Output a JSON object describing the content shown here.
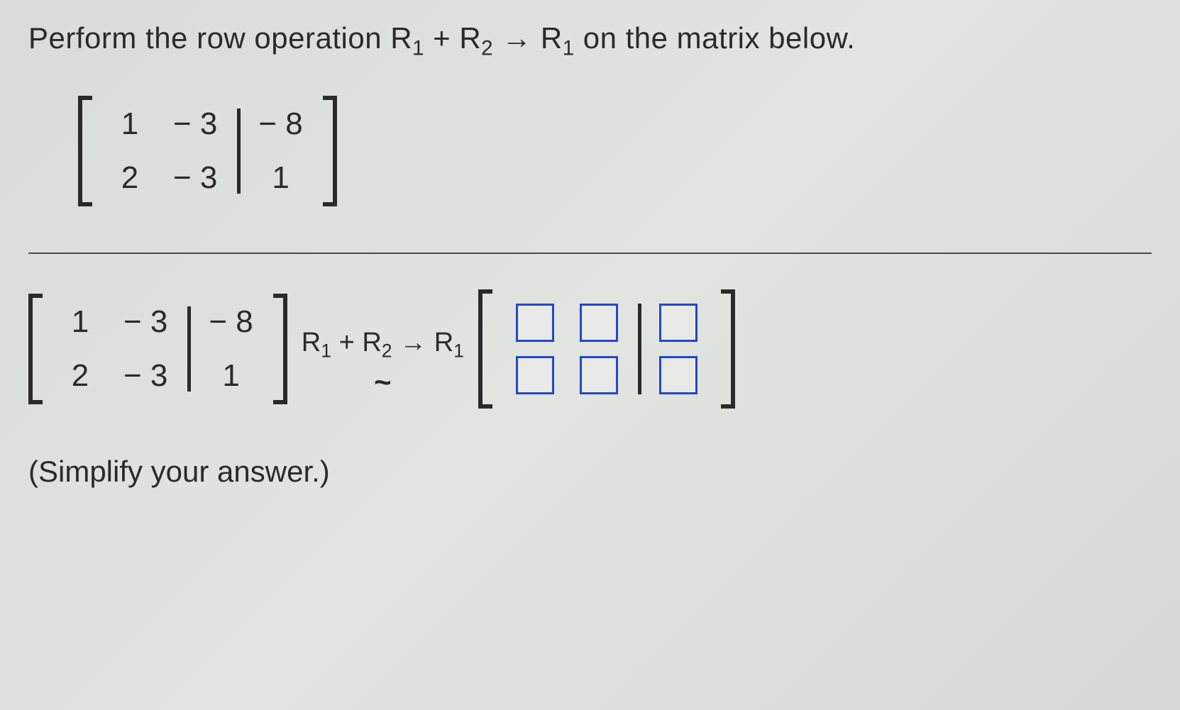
{
  "question": {
    "prefix": "Perform the row operation ",
    "op_r1": "R",
    "op_sub1": "1",
    "op_plus": " + ",
    "op_r2": "R",
    "op_sub2": "2",
    "op_arrow": "→",
    "op_r3": "R",
    "op_sub3": "1",
    "suffix": " on the matrix below."
  },
  "matrix": {
    "r1c1": "1",
    "r1c2": "− 3",
    "r1c3": "− 8",
    "r2c1": "2",
    "r2c2": "− 3",
    "r2c3": "1"
  },
  "answer_op": {
    "r1": "R",
    "s1": "1",
    "plus": " + ",
    "r2": "R",
    "s2": "2",
    "arrow": "→",
    "r3": "R",
    "s3": "1"
  },
  "simplify": "(Simplify your answer.)",
  "chart_data": {
    "type": "table",
    "title": "Augmented matrix row operation",
    "operation": "R1 + R2 -> R1",
    "input_matrix": [
      [
        1,
        -3,
        -8
      ],
      [
        2,
        -3,
        1
      ]
    ],
    "augment_column_index": 2,
    "result_matrix_shape": [
      2,
      3
    ],
    "result_matrix": [
      [
        null,
        null,
        null
      ],
      [
        null,
        null,
        null
      ]
    ]
  }
}
